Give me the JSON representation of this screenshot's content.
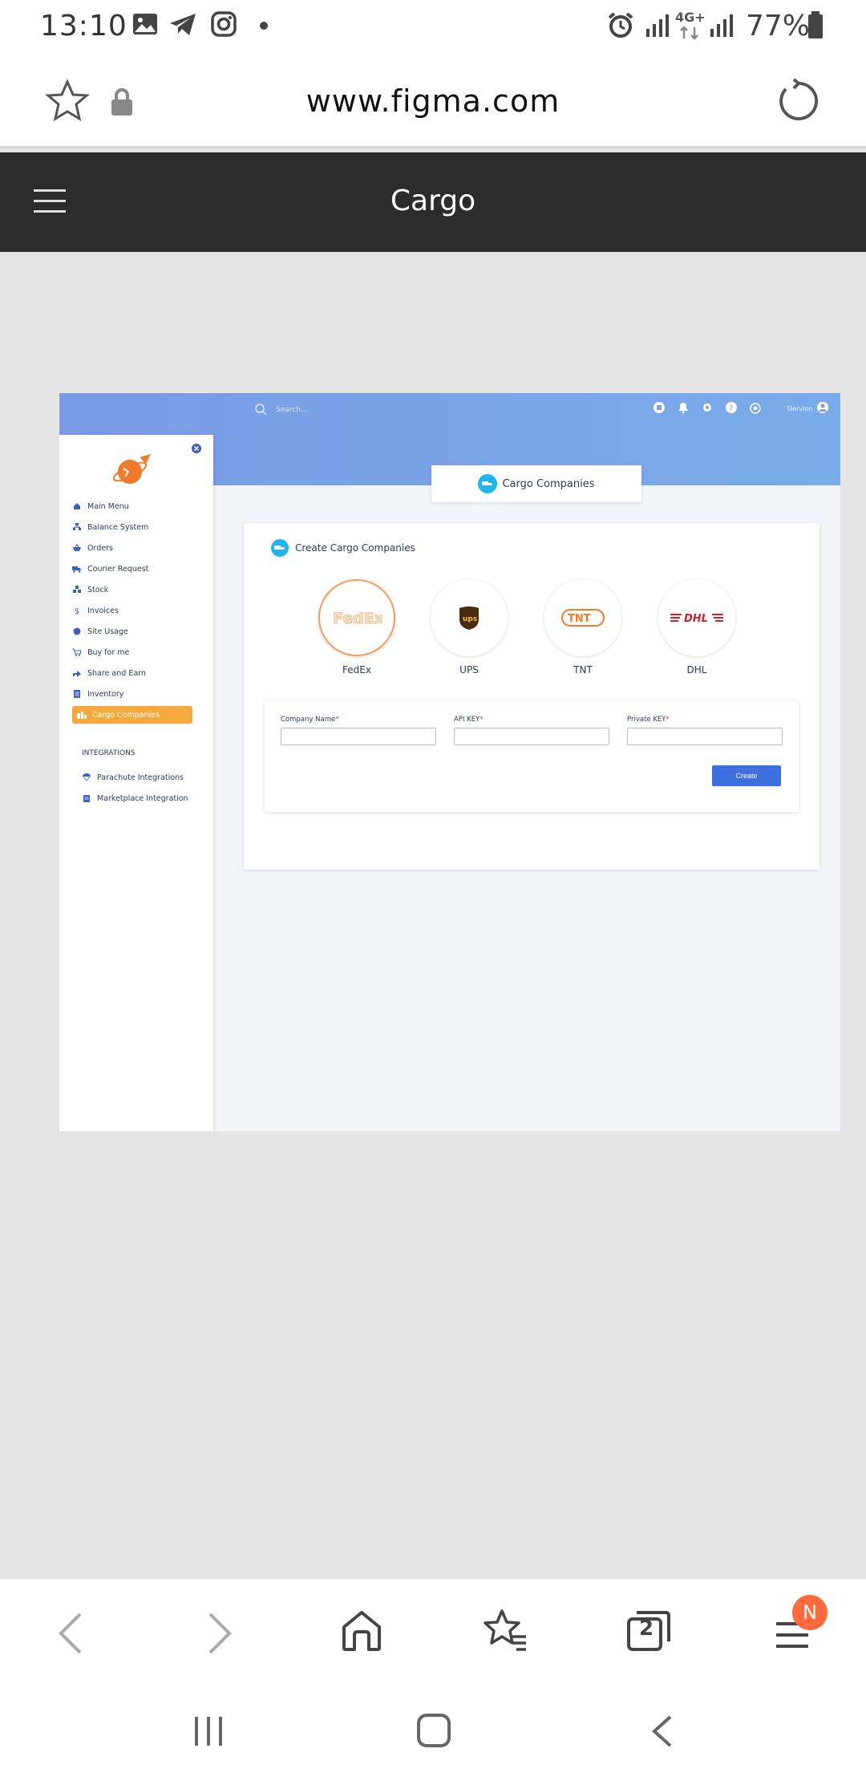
{
  "status_bar": {
    "time": "13:10",
    "network": "4G+",
    "battery": "77%"
  },
  "browser": {
    "url": "www.figma.com",
    "tab_count": "2",
    "menu_badge": "N"
  },
  "figma": {
    "title": "Cargo"
  },
  "app": {
    "search_placeholder": "Search...",
    "user_name": "Dervlon",
    "sidebar": {
      "items": [
        {
          "label": "Main Menu",
          "icon": "home-icon"
        },
        {
          "label": "Balance System",
          "icon": "sitemap-icon"
        },
        {
          "label": "Orders",
          "icon": "basket-icon"
        },
        {
          "label": "Courier Request",
          "icon": "truck-icon"
        },
        {
          "label": "Stock",
          "icon": "boxes-icon"
        },
        {
          "label": "Invoices",
          "icon": "dollar-icon"
        },
        {
          "label": "Site Usage",
          "icon": "chart-icon"
        },
        {
          "label": "Buy for me",
          "icon": "cart-icon"
        },
        {
          "label": "Share and Earn",
          "icon": "share-icon"
        },
        {
          "label": "Inventory",
          "icon": "list-icon"
        },
        {
          "label": "Cargo Companies",
          "icon": "cargo-icon",
          "active": true
        }
      ],
      "integrations_heading": "INTEGRATIONS",
      "integrations": [
        {
          "label": "Parachute Integrations",
          "icon": "parachute-icon"
        },
        {
          "label": "Marketplace Integration",
          "icon": "store-icon"
        }
      ]
    },
    "tab_label": "Cargo Companies",
    "card_title": "Create Cargo Companies",
    "companies": [
      {
        "name": "FedEx",
        "logo": "FedEx",
        "selected": true
      },
      {
        "name": "UPS",
        "logo": "ups"
      },
      {
        "name": "TNT",
        "logo": "TNT"
      },
      {
        "name": "DHL",
        "logo": "DHL"
      }
    ],
    "form": {
      "company_name_label": "Company Name",
      "api_key_label": "API KEY",
      "private_key_label": "Private KEY",
      "required_mark": "*",
      "create_label": "Create"
    },
    "colors": {
      "accent_orange": "#f5a93c",
      "primary_blue": "#3d6fe0",
      "icon_cyan": "#1fb6ef"
    }
  }
}
